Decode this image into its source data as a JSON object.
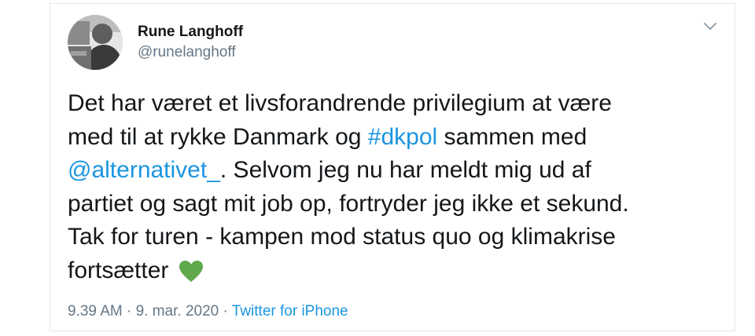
{
  "author": {
    "display_name": "Rune Langhoff",
    "handle": "@runelanghoff"
  },
  "tweet": {
    "segments": [
      {
        "type": "text",
        "value": "Det har været et livsforandrende privilegium at være\nmed til at rykke Danmark og "
      },
      {
        "type": "hashtag",
        "value": "#dkpol"
      },
      {
        "type": "text",
        "value": " sammen med\n"
      },
      {
        "type": "mention",
        "value": "@alternativet_"
      },
      {
        "type": "text",
        "value": ". Selvom jeg nu har meldt mig ud af\npartiet og sagt mit job op, fortryder jeg ikke et sekund.\nTak for turen - kampen mod status quo og klimakrise\nfortsætter "
      }
    ],
    "emoji": "green-heart",
    "emoji_color": "#5fa84b"
  },
  "meta": {
    "time": "9.39 AM",
    "separator1": " · ",
    "date": "9. mar. 2020",
    "separator2": " · ",
    "source": "Twitter for iPhone"
  },
  "icons": {
    "menu": "chevron-down-icon"
  },
  "colors": {
    "link": "#1b95e0",
    "secondary_text": "#657786",
    "primary_text": "#14171a",
    "border": "#e1e8ed"
  }
}
